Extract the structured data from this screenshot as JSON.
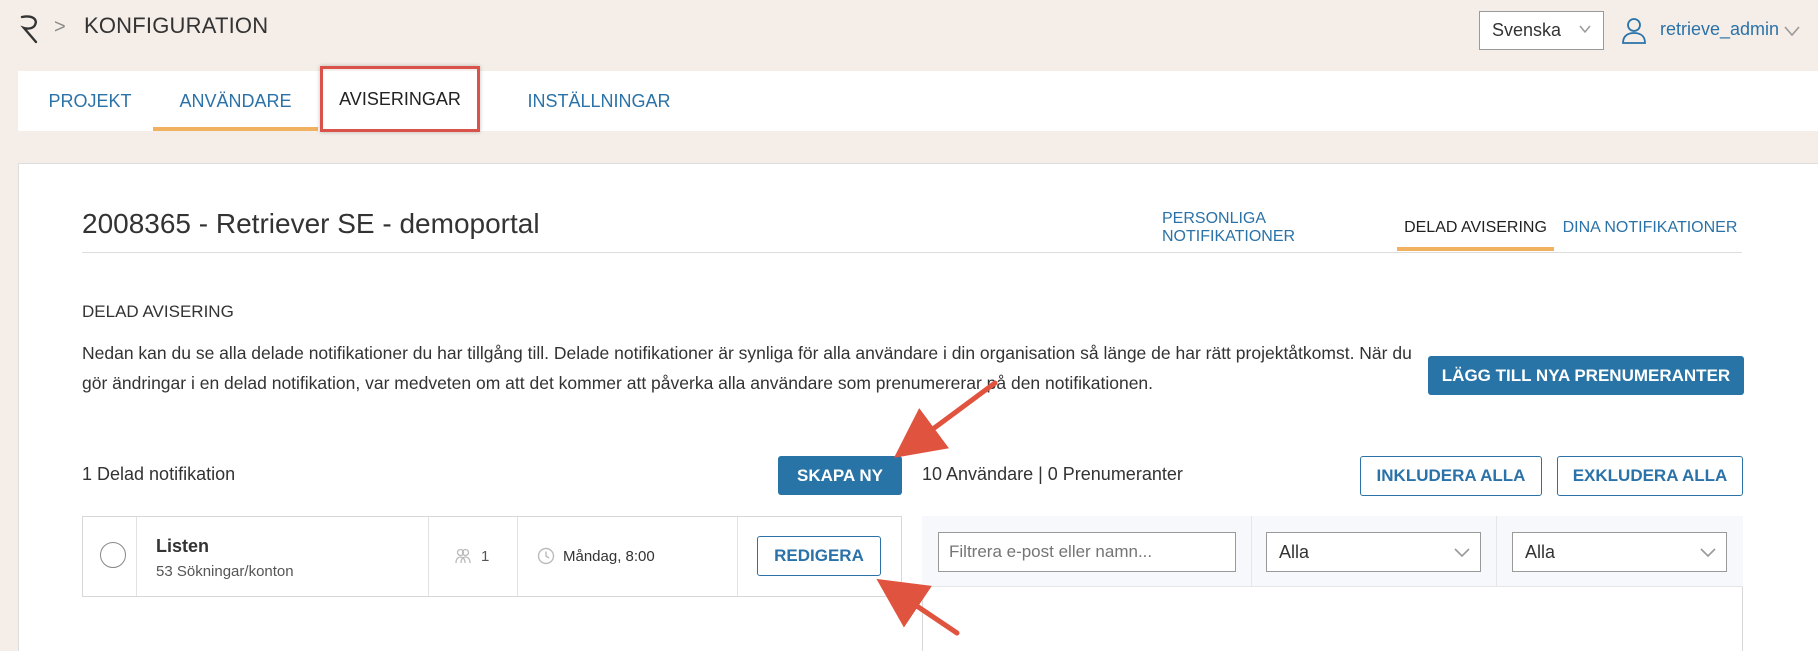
{
  "header": {
    "breadcrumb_separator": ">",
    "title": "KONFIGURATION",
    "language": "Svenska",
    "username": "retrieve_admin"
  },
  "tabs": [
    {
      "label": "PROJEKT"
    },
    {
      "label": "ANVÄNDARE"
    },
    {
      "label": "AVISERINGAR"
    },
    {
      "label": "INSTÄLLNINGAR"
    }
  ],
  "page": {
    "title": "2008365 - Retriever SE - demoportal",
    "subtabs": [
      {
        "label": "PERSONLIGA NOTIFIKATIONER"
      },
      {
        "label": "DELAD AVISERING"
      },
      {
        "label": "DINA NOTIFIKATIONER"
      }
    ],
    "section_heading": "DELAD AVISERING",
    "description": "Nedan kan du se alla delade notifikationer du har tillgång till. Delade notifikationer är synliga för alla användare i din organisation så länge de har rätt projektåtkomst. När du gör ändringar i en delad notifikation, var medveten om att det kommer att påverka alla användare som prenumererar på den notifikationen.",
    "add_subscribers_button": "LÄGG TILL NYA PRENUMERANTER",
    "count_label": "1 Delad notifikation",
    "create_button": "SKAPA NY",
    "stats": "10 Användare | 0 Prenumeranter",
    "include_all_button": "INKLUDERA ALLA",
    "exclude_all_button": "EXKLUDERA ALLA"
  },
  "notification": {
    "name": "Listen",
    "subtitle": "53 Sökningar/konton",
    "people_count": "1",
    "schedule": "Måndag, 8:00",
    "edit_button": "REDIGERA"
  },
  "filters": {
    "search_placeholder": "Filtrera e-post eller namn...",
    "select1": "Alla",
    "select2": "Alla"
  },
  "colors": {
    "accent_blue": "#2874a6",
    "link_blue": "#2a72a8",
    "tab_underline": "#f2b061",
    "highlight_border": "#d9534a",
    "annotation_arrow": "#e0533e"
  }
}
